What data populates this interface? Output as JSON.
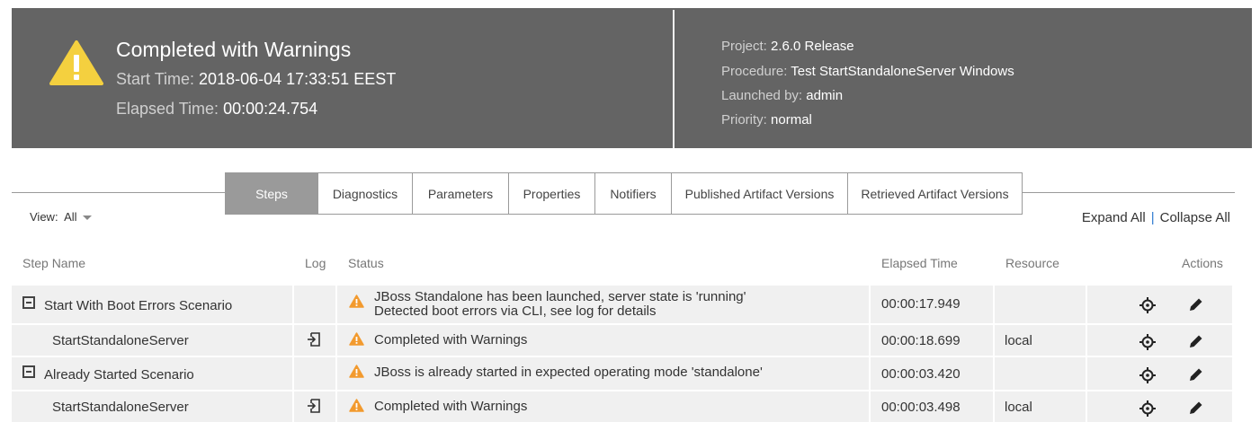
{
  "header": {
    "title": "Completed with Warnings",
    "start_label": "Start Time:",
    "start_value": "2018-06-04 17:33:51 EEST",
    "elapsed_label": "Elapsed Time:",
    "elapsed_value": "00:00:24.754",
    "project_label": "Project:",
    "project_value": "2.6.0 Release",
    "procedure_label": "Procedure:",
    "procedure_value": "Test StartStandaloneServer Windows",
    "launched_label": "Launched by:",
    "launched_value": "admin",
    "priority_label": "Priority:",
    "priority_value": "normal"
  },
  "tabs": [
    {
      "label": "Steps"
    },
    {
      "label": "Diagnostics"
    },
    {
      "label": "Parameters"
    },
    {
      "label": "Properties"
    },
    {
      "label": "Notifiers"
    },
    {
      "label": "Published Artifact Versions"
    },
    {
      "label": "Retrieved Artifact Versions"
    }
  ],
  "view": {
    "label": "View:",
    "value": "All"
  },
  "expand_all": "Expand All",
  "separator": "|",
  "collapse_all": "Collapse All",
  "columns": {
    "step_name": "Step Name",
    "log": "Log",
    "status": "Status",
    "elapsed": "Elapsed Time",
    "resource": "Resource",
    "actions": "Actions"
  },
  "rows": [
    {
      "name": "Start With Boot Errors Scenario",
      "status_line1": "JBoss Standalone has been launched, server state is 'running'",
      "status_line2": "Detected boot errors via CLI, see log for details",
      "elapsed": "00:00:17.949",
      "resource": ""
    },
    {
      "name": "StartStandaloneServer",
      "status_line1": "Completed with Warnings",
      "elapsed": "00:00:18.699",
      "resource": "local"
    },
    {
      "name": "Already Started Scenario",
      "status_line1": "JBoss is already started in expected operating mode 'standalone'",
      "elapsed": "00:00:03.420",
      "resource": ""
    },
    {
      "name": "StartStandaloneServer",
      "status_line1": "Completed with Warnings",
      "elapsed": "00:00:03.498",
      "resource": "local"
    }
  ],
  "icons": {
    "warning": "warning-icon",
    "collapse": "collapse-box-icon",
    "log": "log-icon",
    "locate": "crosshair-icon",
    "edit": "pencil-icon"
  },
  "colors": {
    "header_bg": "#646464",
    "warning": "#f29a2e",
    "warning_big": "#f4d03f",
    "active_tab": "#9a9a9a",
    "row_bg": "#f0f0f0"
  }
}
